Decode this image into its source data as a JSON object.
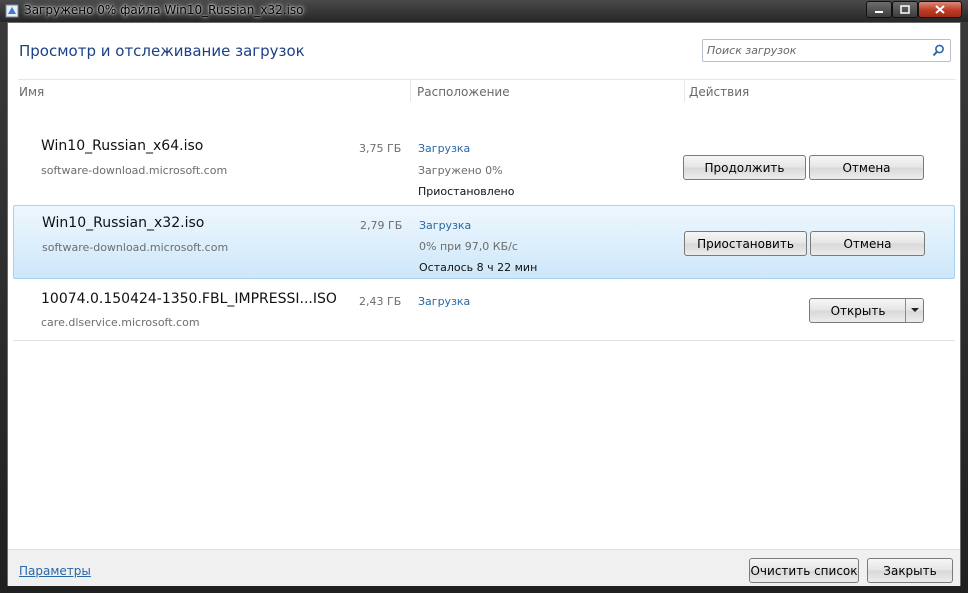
{
  "window": {
    "title": "Загружено 0% файла Win10_Russian_x32.iso"
  },
  "header": {
    "title": "Просмотр и отслеживание загрузок",
    "search_placeholder": "Поиск загрузок"
  },
  "columns": {
    "name": "Имя",
    "location": "Расположение",
    "actions": "Действия"
  },
  "downloads": [
    {
      "name": "Win10_Russian_x64.iso",
      "host": "software-download.microsoft.com",
      "size": "3,75 ГБ",
      "location_link": "Загрузка",
      "status_line": "Загружено 0%",
      "status_bold": "Приостановлено",
      "primary_action": "Продолжить",
      "secondary_action": "Отмена"
    },
    {
      "name": "Win10_Russian_x32.iso",
      "host": "software-download.microsoft.com",
      "size": "2,79 ГБ",
      "location_link": "Загрузка",
      "status_line": "0% при 97,0 КБ/с",
      "status_bold": "Осталось  8 ч 22 мин",
      "primary_action": "Приостановить",
      "secondary_action": "Отмена",
      "selected": true
    },
    {
      "name": "10074.0.150424-1350.FBL_IMPRESSI...ISO",
      "host": "care.dlservice.microsoft.com",
      "size": "2,43 ГБ",
      "location_link": "Загрузка",
      "open_action": "Открыть"
    }
  ],
  "footer": {
    "settings_link": "Параметры",
    "clear_list_button": "Очистить список",
    "close_button": "Закрыть"
  }
}
